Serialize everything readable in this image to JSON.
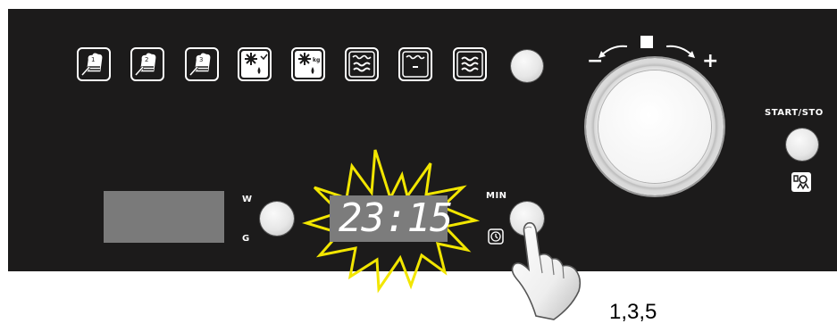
{
  "panel": {
    "program_icons": [
      {
        "name": "chef-hat-1-icon"
      },
      {
        "name": "chef-hat-2-icon"
      },
      {
        "name": "chef-hat-3-icon"
      },
      {
        "name": "defrost-weight-icon"
      },
      {
        "name": "defrost-time-icon"
      },
      {
        "name": "grill-top-icon"
      },
      {
        "name": "grill-single-icon"
      },
      {
        "name": "grill-combination-icon"
      }
    ],
    "weight_toggle": {
      "top_label": "W",
      "bottom_label": "G"
    },
    "display_time": "23:15",
    "min_button_label": "MIN",
    "start_stop_label": "START/STO",
    "dial_minus": "−",
    "dial_plus": "+"
  },
  "annotation": {
    "steps_caption": "1,3,5"
  }
}
